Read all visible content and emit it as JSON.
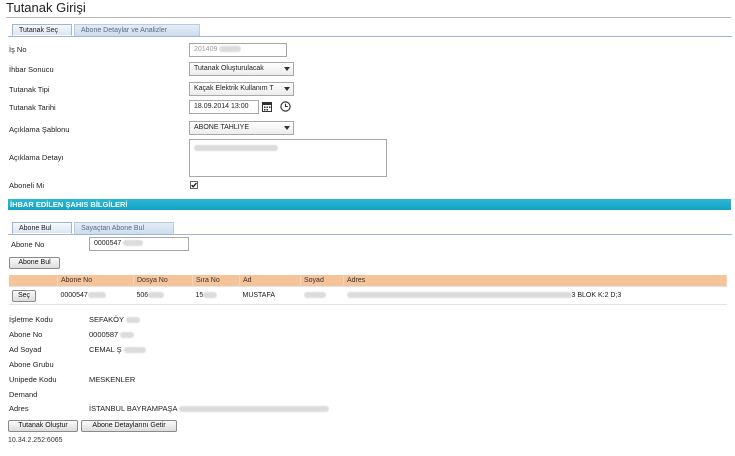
{
  "page": {
    "title": "Tutanak Girişi"
  },
  "tabs_top": [
    {
      "label": "Tutanak Seç"
    },
    {
      "label": "Abone Detaylar ve Analizler"
    }
  ],
  "form": {
    "is_no": {
      "label": "İş No",
      "value": "201409"
    },
    "ihbar_sonucu": {
      "label": "İhbar Sonucu",
      "value": "Tutanak Oluşturulacak"
    },
    "tutanak_tipi": {
      "label": "Tutanak Tipi",
      "value": "Kaçak Elektrik Kullanım T"
    },
    "tutanak_tarihi": {
      "label": "Tutanak Tarihi",
      "value": "18.09.2014 13:00"
    },
    "aciklama_sablonu": {
      "label": "Açıklama Şablonu",
      "value": "ABONE TAHLIYE"
    },
    "aciklama_detayi": {
      "label": "Açıklama Detayı",
      "value": ""
    },
    "aboneli_mi": {
      "label": "Aboneli Mi",
      "checked": true
    }
  },
  "section": {
    "title": "İHBAR EDİLEN ŞAHIS BİLGİLERİ"
  },
  "tabs_bottom": [
    {
      "label": "Abone Bul"
    },
    {
      "label": "Sayaçtan Abone Bul"
    }
  ],
  "search": {
    "label": "Abone No",
    "value": "0000547",
    "button": "Abone Bul"
  },
  "grid": {
    "columns": [
      "",
      "Abone No",
      "Dosya No",
      "Sıra No",
      "Ad",
      "Soyad",
      "Adres"
    ],
    "rows": [
      {
        "select_label": "Seç",
        "abone_no": "0000547",
        "dosya_no": "506",
        "sira_no": "15",
        "ad": "MUSTAFA",
        "soyad": "",
        "adres": "3 BLOK K:2 D;3"
      }
    ]
  },
  "details": [
    {
      "label": "İşletme Kodu",
      "value": "SEFAKÖY"
    },
    {
      "label": "Abone No",
      "value": "0000587"
    },
    {
      "label": "Ad Soyad",
      "value": "CEMAL Ş"
    },
    {
      "label": "Abone Grubu",
      "value": ""
    },
    {
      "label": "Unipede Kodu",
      "value": "MESKENLER"
    },
    {
      "label": "Demand",
      "value": ""
    },
    {
      "label": "Adres",
      "value": "İSTANBUL BAYRAMPAŞA"
    }
  ],
  "actions": {
    "create": "Tutanak Oluştur",
    "details": "Abone Detaylarını Getir"
  },
  "footer": {
    "ip": "10.34.2.252:6065"
  },
  "colors": {
    "section_bar": "#1faacb",
    "grid_header": "#f5c49b",
    "tab_border": "#9cb6d4"
  },
  "icons": {
    "calendar": "calendar-icon",
    "clock": "clock-icon"
  }
}
